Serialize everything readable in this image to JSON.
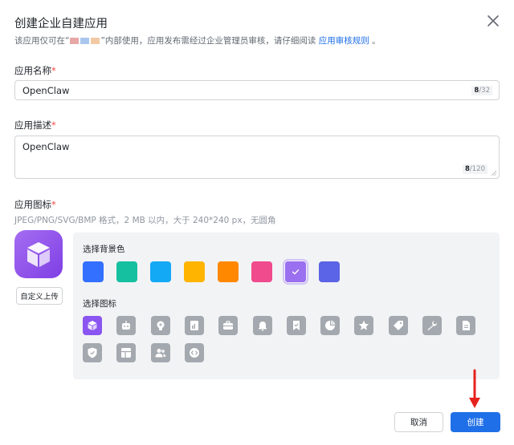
{
  "dialog": {
    "title": "创建企业自建应用",
    "subtitle_prefix": "该应用仅可在“",
    "subtitle_middle": "”内部使用，应用发布需经过企业管理员审核，请仔细阅读",
    "subtitle_link": "应用审核规则",
    "subtitle_suffix": "。"
  },
  "name_field": {
    "label": "应用名称",
    "required_mark": "*",
    "value": "OpenClaw",
    "count_current": "8",
    "count_max": "/32"
  },
  "desc_field": {
    "label": "应用描述",
    "required_mark": "*",
    "value": "OpenClaw",
    "count_current": "8",
    "count_max": "/120"
  },
  "icon_field": {
    "label": "应用图标",
    "required_mark": "*",
    "hint": "JPEG/PNG/SVG/BMP 格式，2 MB 以内，大于 240*240 px，无圆角",
    "upload_label": "自定义上传"
  },
  "picker": {
    "bg_label": "选择背景色",
    "icon_label": "选择图标",
    "colors": [
      "#3370ff",
      "#14c0a0",
      "#14a9f5",
      "#ffb400",
      "#ff8800",
      "#f04b8c",
      "#9a6ff0",
      "#5b63e6"
    ],
    "selected_color_index": 6,
    "icons": [
      "cube-icon",
      "robot-icon",
      "bulb-icon",
      "document-chart-icon",
      "briefcase-icon",
      "bell-icon",
      "bookmark-check-icon",
      "pie-chart-icon",
      "star-icon",
      "tag-icon",
      "wrench-icon",
      "file-icon",
      "shield-check-icon",
      "layout-icon",
      "people-icon",
      "code-icon"
    ],
    "selected_icon_index": 0
  },
  "footer": {
    "cancel_label": "取消",
    "create_label": "创建"
  }
}
